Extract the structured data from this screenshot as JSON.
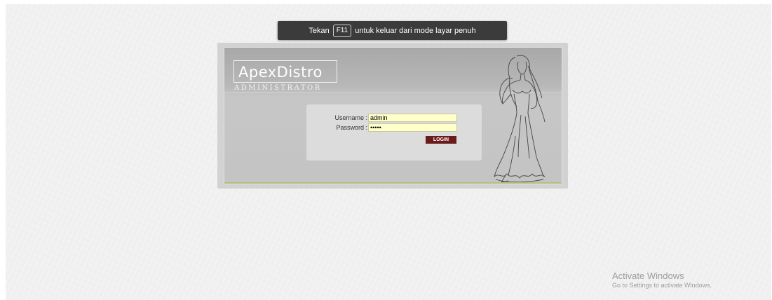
{
  "fullscreen_notice": {
    "prefix": "Tekan",
    "key": "F11",
    "suffix": "untuk keluar dari mode layar penuh"
  },
  "brand": {
    "logo": "ApexDistro",
    "subtitle": "ADMINISTRATOR"
  },
  "login": {
    "username_label": "Username :",
    "username_value": "admin",
    "password_label": "Password :",
    "password_value": "admin",
    "button_label": "LOGIN"
  },
  "watermark": {
    "title": "Activate Windows",
    "subtitle": "Go to Settings to activate Windows."
  },
  "colors": {
    "notice_bg": "#3b3b3b",
    "input_bg": "#ffffcc",
    "button_bg": "#6b1b1b",
    "panel_bg": "#c4c4c4"
  }
}
